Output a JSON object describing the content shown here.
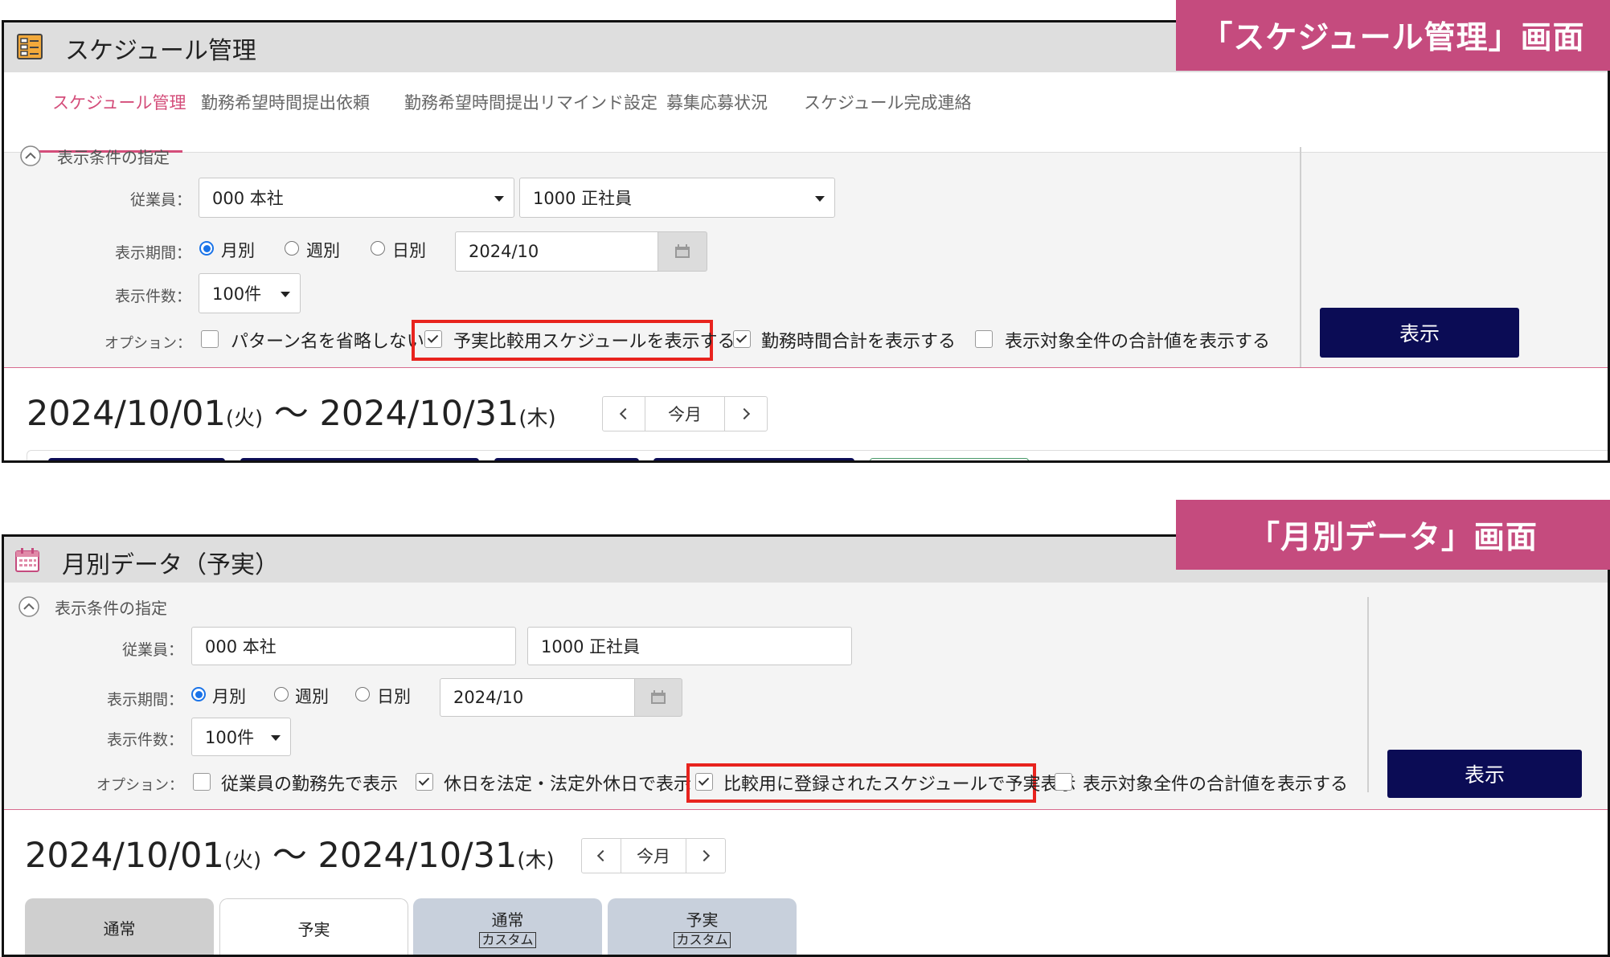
{
  "screen1": {
    "title": "スケジュール管理",
    "banner": "「スケジュール管理」画面",
    "nav": [
      {
        "label": "スケジュール管理",
        "active": true
      },
      {
        "label": "勤務希望時間提出依頼"
      },
      {
        "label": "勤務希望時間提出リマインド設定"
      },
      {
        "label": "募集応募状況"
      },
      {
        "label": "スケジュール完成連絡"
      }
    ],
    "filter_header": "表示条件の指定",
    "employee_label": "従業員：",
    "employee_select1": "000 本社",
    "employee_select2": "1000 正社員",
    "period_label": "表示期間：",
    "period_options": [
      "月別",
      "週別",
      "日別"
    ],
    "period_selected": "月別",
    "period_value": "2024/10",
    "count_label": "表示件数：",
    "count_value": "100件",
    "options_label": "オプション：",
    "options": [
      {
        "label": "パターン名を省略しない",
        "checked": false
      },
      {
        "label": "予実比較用スケジュールを表示する",
        "checked": true,
        "highlighted": true
      },
      {
        "label": "勤務時間合計を表示する",
        "checked": true
      },
      {
        "label": "表示対象全件の合計値を表示する",
        "checked": false
      }
    ],
    "show_button": "表示",
    "date_start": "2024/10/01",
    "date_start_day": "(火)",
    "date_sep": "〜",
    "date_end": "2024/10/31",
    "date_end_day": "(木)",
    "pager_current": "今月"
  },
  "screen2": {
    "title": "月別データ（予実）",
    "banner": "「月別データ」画面",
    "filter_header": "表示条件の指定",
    "employee_label": "従業員：",
    "employee_field1": "000 本社",
    "employee_field2": "1000 正社員",
    "period_label": "表示期間：",
    "period_options": [
      "月別",
      "週別",
      "日別"
    ],
    "period_selected": "月別",
    "period_value": "2024/10",
    "count_label": "表示件数：",
    "count_value": "100件",
    "options_label": "オプション：",
    "options": [
      {
        "label": "従業員の勤務先で表示",
        "checked": false
      },
      {
        "label": "休日を法定・法定外休日で表示",
        "checked": true
      },
      {
        "label": "比較用に登録されたスケジュールで予実表示",
        "checked": true,
        "highlighted": true
      },
      {
        "label": "表示対象全件の合計値を表示する",
        "checked": false
      }
    ],
    "show_button": "表示",
    "date_start": "2024/10/01",
    "date_start_day": "(火)",
    "date_sep": "〜",
    "date_end": "2024/10/31",
    "date_end_day": "(木)",
    "pager_current": "今月",
    "content_tabs": [
      {
        "label": "通常",
        "sub": ""
      },
      {
        "label": "予実",
        "sub": ""
      },
      {
        "label": "通常",
        "sub": "カスタム"
      },
      {
        "label": "予実",
        "sub": "カスタム"
      }
    ]
  },
  "icons": {
    "app1": "schedule-list-icon",
    "app2": "calendar-icon",
    "collapse": "chevron-up-circle-icon",
    "calendar_picker": "calendar-icon",
    "prev": "chevron-left-icon",
    "next": "chevron-right-icon"
  },
  "colors": {
    "banner": "#c54b7e",
    "accent_pink": "#d44d7a",
    "primary_button": "#0b0c55",
    "highlight_box": "#e8231e",
    "radio_selected": "#1a73e8"
  }
}
